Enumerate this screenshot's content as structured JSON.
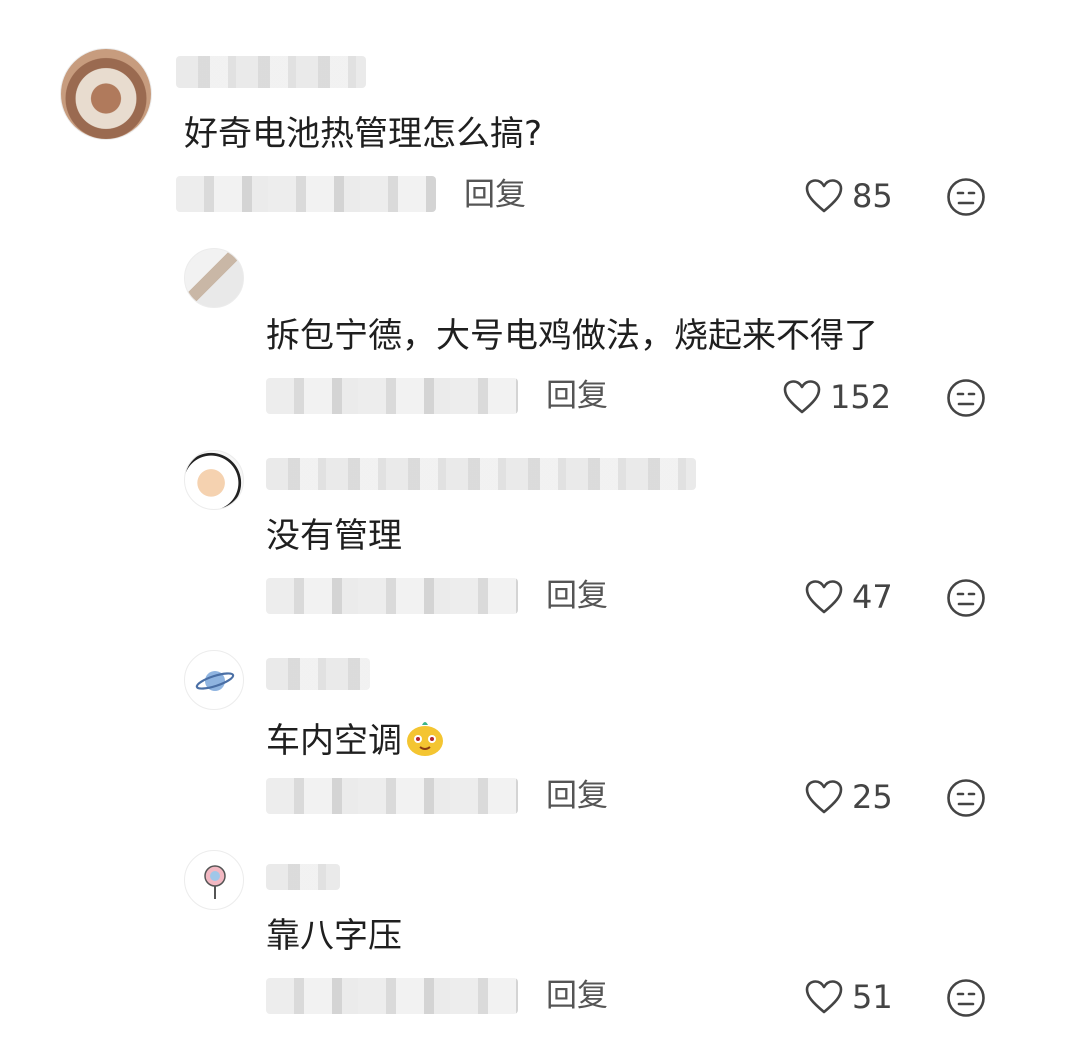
{
  "comments": [
    {
      "text": "好奇电池热管理怎么搞?",
      "reply_label": "回复",
      "likes": "85",
      "is_reply": false
    },
    {
      "text": "拆包宁德，大号电鸡做法，烧起来不得了",
      "reply_label": "回复",
      "likes": "152",
      "is_reply": true
    },
    {
      "text": "没有管理",
      "reply_label": "回复",
      "likes": "47",
      "is_reply": true
    },
    {
      "text": "车内空调",
      "reply_label": "回复",
      "likes": "25",
      "is_reply": true,
      "inline_emoji": "sticker-emoji"
    },
    {
      "text": "靠八字压",
      "reply_label": "回复",
      "likes": "51",
      "is_reply": true
    }
  ],
  "icons": {
    "like": "heart-outline-icon",
    "react": "neutral-face-icon"
  },
  "colors": {
    "text": "#1f1f1f",
    "meta": "#555555",
    "icon": "#444444"
  }
}
